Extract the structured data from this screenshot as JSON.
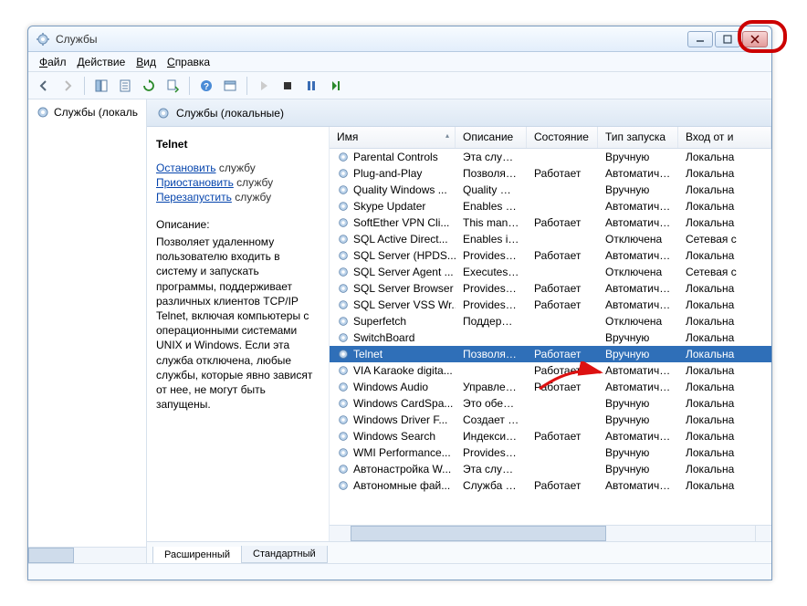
{
  "window": {
    "title": "Службы"
  },
  "menubar": [
    {
      "label": "Файл",
      "u": 0
    },
    {
      "label": "Действие",
      "u": 0
    },
    {
      "label": "Вид",
      "u": 0
    },
    {
      "label": "Справка",
      "u": 0
    }
  ],
  "leftpane": {
    "node": "Службы (локаль"
  },
  "rightpane_header": "Службы (локальные)",
  "detail": {
    "name": "Telnet",
    "actions": [
      {
        "link": "Остановить",
        "rest": " службу"
      },
      {
        "link": "Приостановить",
        "rest": " службу"
      },
      {
        "link": "Перезапустить",
        "rest": " службу"
      }
    ],
    "desc_label": "Описание:",
    "desc": "Позволяет удаленному пользователю входить в систему и запускать программы, поддерживает различных клиентов TCP/IP Telnet, включая компьютеры с операционными системами UNIX и Windows. Если эта служба отключена, любые службы, которые явно зависят от нее, не могут быть запущены."
  },
  "columns": {
    "name": "Имя",
    "desc": "Описание",
    "state": "Состояние",
    "start": "Тип запуска",
    "logon": "Вход от и"
  },
  "rows": [
    {
      "name": "Parental Controls",
      "desc": "Эта служб...",
      "state": "",
      "start": "Вручную",
      "logon": "Локальна"
    },
    {
      "name": "Plug-and-Play",
      "desc": "Позволяет...",
      "state": "Работает",
      "start": "Автоматиче...",
      "logon": "Локальна"
    },
    {
      "name": "Quality Windows ...",
      "desc": "Quality Wi...",
      "state": "",
      "start": "Вручную",
      "logon": "Локальна"
    },
    {
      "name": "Skype Updater",
      "desc": "Enables th...",
      "state": "",
      "start": "Автоматиче...",
      "logon": "Локальна"
    },
    {
      "name": "SoftEther VPN Cli...",
      "desc": "This mana...",
      "state": "Работает",
      "start": "Автоматиче...",
      "logon": "Локальна"
    },
    {
      "name": "SQL Active Direct...",
      "desc": "Enables int...",
      "state": "",
      "start": "Отключена",
      "logon": "Сетевая с"
    },
    {
      "name": "SQL Server (HPDS...",
      "desc": "Provides st...",
      "state": "Работает",
      "start": "Автоматиче...",
      "logon": "Локальна"
    },
    {
      "name": "SQL Server Agent ...",
      "desc": "Executes jo...",
      "state": "",
      "start": "Отключена",
      "logon": "Сетевая с"
    },
    {
      "name": "SQL Server Browser",
      "desc": "Provides th...",
      "state": "Работает",
      "start": "Автоматиче...",
      "logon": "Локальна"
    },
    {
      "name": "SQL Server VSS Wr...",
      "desc": "Provides th...",
      "state": "Работает",
      "start": "Автоматиче...",
      "logon": "Локальна"
    },
    {
      "name": "Superfetch",
      "desc": "Поддержи...",
      "state": "",
      "start": "Отключена",
      "logon": "Локальна"
    },
    {
      "name": "SwitchBoard",
      "desc": "",
      "state": "",
      "start": "Вручную",
      "logon": "Локальна"
    },
    {
      "name": "Telnet",
      "desc": "Позволяет...",
      "state": "Работает",
      "start": "Вручную",
      "logon": "Локальна",
      "selected": true
    },
    {
      "name": "VIA Karaoke digita...",
      "desc": "",
      "state": "Работает",
      "start": "Автоматиче...",
      "logon": "Локальна"
    },
    {
      "name": "Windows Audio",
      "desc": "Управлен...",
      "state": "Работает",
      "start": "Автоматиче...",
      "logon": "Локальна"
    },
    {
      "name": "Windows CardSpa...",
      "desc": "Это обесп...",
      "state": "",
      "start": "Вручную",
      "logon": "Локальна"
    },
    {
      "name": "Windows Driver F...",
      "desc": "Создает п...",
      "state": "",
      "start": "Вручную",
      "logon": "Локальна"
    },
    {
      "name": "Windows Search",
      "desc": "Индексир...",
      "state": "Работает",
      "start": "Автоматиче...",
      "logon": "Локальна"
    },
    {
      "name": "WMI Performance...",
      "desc": "Provides p...",
      "state": "",
      "start": "Вручную",
      "logon": "Локальна"
    },
    {
      "name": "Автонастройка W...",
      "desc": "Эта служб...",
      "state": "",
      "start": "Вручную",
      "logon": "Локальна"
    },
    {
      "name": "Автономные фай...",
      "desc": "Служба ав...",
      "state": "Работает",
      "start": "Автоматиче...",
      "logon": "Локальна"
    }
  ],
  "tabs": [
    {
      "label": "Расширенный",
      "active": true
    },
    {
      "label": "Стандартный",
      "active": false
    }
  ]
}
